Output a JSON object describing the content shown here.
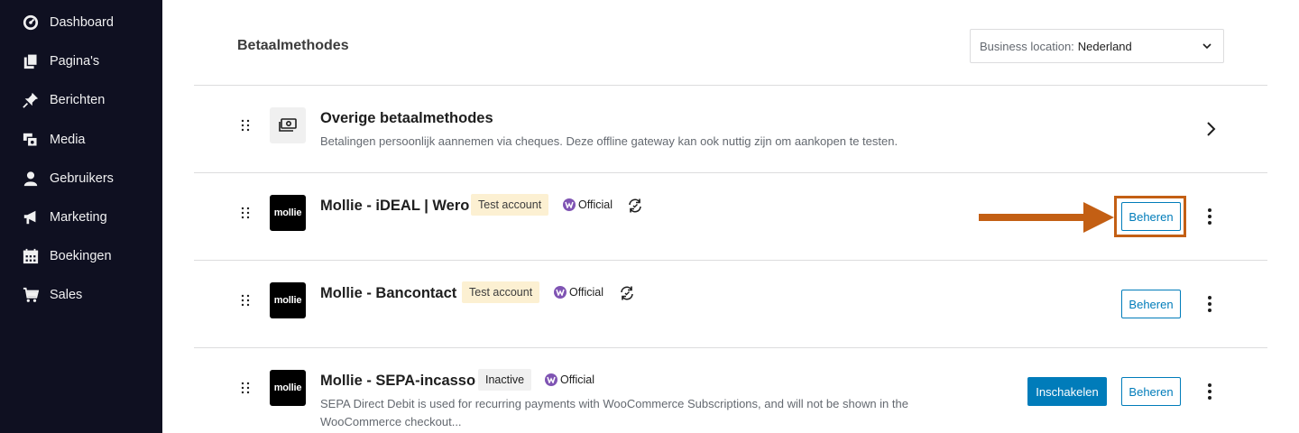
{
  "sidebar": {
    "items": [
      {
        "label": "Dashboard",
        "icon": "dashboard-icon"
      },
      {
        "label": "Pagina's",
        "icon": "pages-icon"
      },
      {
        "label": "Berichten",
        "icon": "pin-icon"
      },
      {
        "label": "Media",
        "icon": "media-icon"
      },
      {
        "label": "Gebruikers",
        "icon": "user-icon"
      },
      {
        "label": "Marketing",
        "icon": "megaphone-icon"
      },
      {
        "label": "Boekingen",
        "icon": "calendar-icon"
      },
      {
        "label": "Sales",
        "icon": "cart-icon"
      }
    ]
  },
  "header": {
    "title": "Betaalmethodes",
    "location_label": "Business location:",
    "location_value": "Nederland"
  },
  "rows": [
    {
      "title": "Overige betaalmethodes",
      "description": "Betalingen persoonlijk aannemen via cheques. Deze offline gateway kan ook nuttig zijn om aankopen te testen."
    },
    {
      "title": "Mollie - iDEAL | Wero",
      "logo": "mollie",
      "badge": "Test account",
      "official": "Official",
      "manage": "Beheren"
    },
    {
      "title": "Mollie - Bancontact",
      "logo": "mollie",
      "badge": "Test account",
      "official": "Official",
      "manage": "Beheren"
    },
    {
      "title": "Mollie - SEPA-incasso",
      "logo": "mollie",
      "badge": "Inactive",
      "official": "Official",
      "description": "SEPA Direct Debit is used for recurring payments with WooCommerce Subscriptions, and will not be shown in the WooCommerce checkout...",
      "enable": "Inschakelen",
      "manage": "Beheren"
    }
  ],
  "colors": {
    "sidebar_bg": "#0f1021",
    "accent": "#007cba",
    "highlight": "#c35f14",
    "test_badge": "#fcf0d2",
    "official_purple": "#7f54b3"
  }
}
